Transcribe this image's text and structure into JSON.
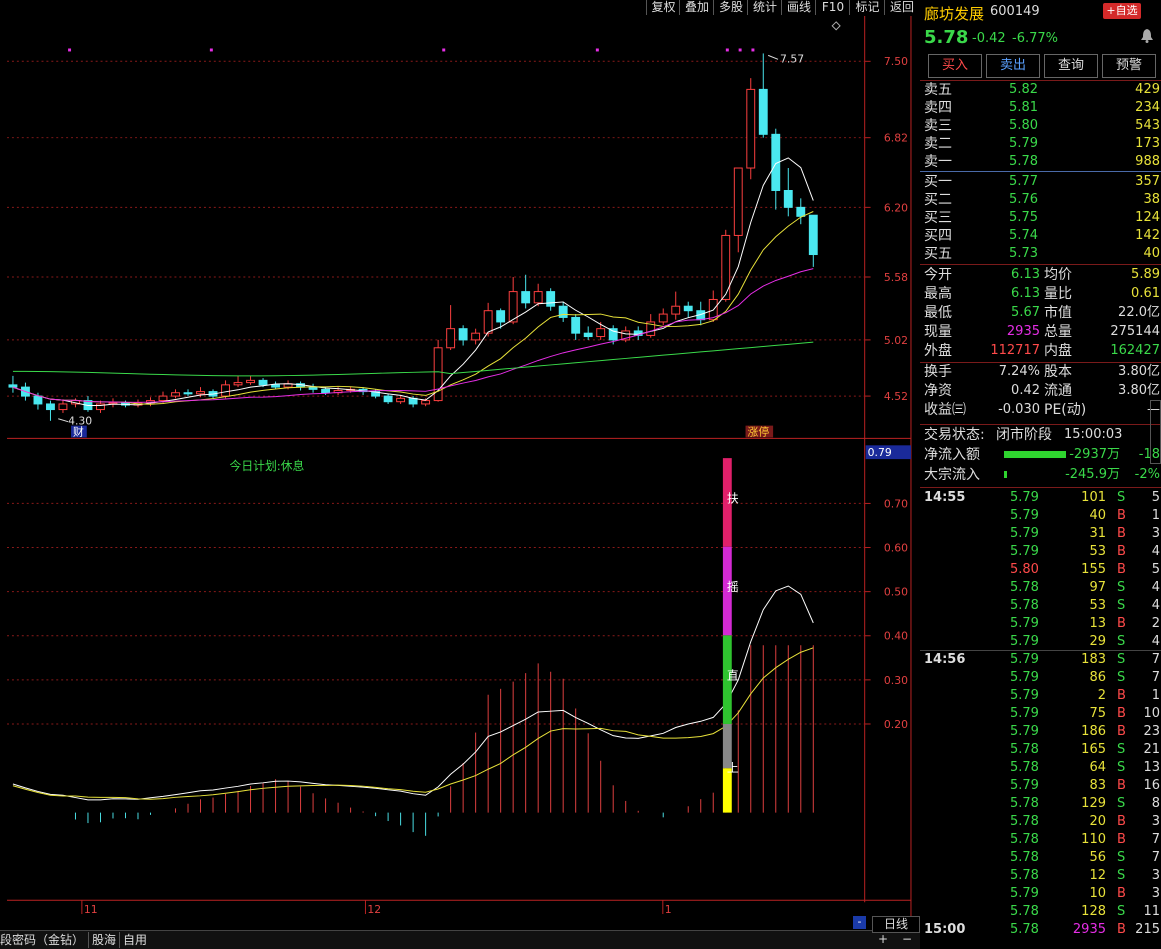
{
  "toolbar": {
    "buttons": [
      "复权",
      "叠加",
      "多股",
      "统计",
      "画线",
      "F10",
      "标记",
      "返回"
    ]
  },
  "chart_data": {
    "type": "candlestick",
    "price_axis_ticks": [
      "7.50",
      "6.82",
      "6.20",
      "5.58",
      "5.02",
      "4.52"
    ],
    "indicator_axis_ticks": [
      "0.70",
      "0.60",
      "0.50",
      "0.40",
      "0.30",
      "0.20"
    ],
    "indicator_current": "0.79",
    "x_ticks": [
      "11",
      "12",
      "1"
    ],
    "high_label": "7.57",
    "low_label": "4.30",
    "marker_labels": [
      "财",
      "涨停"
    ],
    "annotation": "今日计划:休息",
    "bar_labels": [
      "扶",
      "摇",
      "直",
      "上"
    ],
    "candles": [
      [
        4.62,
        4.6,
        4.7,
        4.55
      ],
      [
        4.6,
        4.52,
        4.64,
        4.48
      ],
      [
        4.52,
        4.45,
        4.55,
        4.4
      ],
      [
        4.45,
        4.4,
        4.48,
        4.3
      ],
      [
        4.4,
        4.45,
        4.49,
        4.37
      ],
      [
        4.45,
        4.48,
        4.5,
        4.42
      ],
      [
        4.48,
        4.4,
        4.52,
        4.38
      ],
      [
        4.4,
        4.45,
        4.48,
        4.37
      ],
      [
        4.45,
        4.46,
        4.5,
        4.42
      ],
      [
        4.46,
        4.44,
        4.48,
        4.42
      ],
      [
        4.44,
        4.46,
        4.49,
        4.42
      ],
      [
        4.46,
        4.48,
        4.51,
        4.43
      ],
      [
        4.48,
        4.52,
        4.56,
        4.46
      ],
      [
        4.52,
        4.55,
        4.58,
        4.5
      ],
      [
        4.55,
        4.54,
        4.58,
        4.52
      ],
      [
        4.54,
        4.56,
        4.6,
        4.51
      ],
      [
        4.56,
        4.52,
        4.58,
        4.5
      ],
      [
        4.52,
        4.62,
        4.66,
        4.5
      ],
      [
        4.62,
        4.64,
        4.7,
        4.6
      ],
      [
        4.64,
        4.66,
        4.7,
        4.62
      ],
      [
        4.66,
        4.62,
        4.68,
        4.6
      ],
      [
        4.62,
        4.6,
        4.65,
        4.58
      ],
      [
        4.6,
        4.63,
        4.66,
        4.58
      ],
      [
        4.63,
        4.6,
        4.65,
        4.57
      ],
      [
        4.6,
        4.58,
        4.63,
        4.55
      ],
      [
        4.58,
        4.55,
        4.6,
        4.53
      ],
      [
        4.55,
        4.57,
        4.6,
        4.53
      ],
      [
        4.57,
        4.58,
        4.6,
        4.55
      ],
      [
        4.58,
        4.56,
        4.6,
        4.53
      ],
      [
        4.56,
        4.52,
        4.58,
        4.5
      ],
      [
        4.52,
        4.47,
        4.54,
        4.45
      ],
      [
        4.47,
        4.5,
        4.53,
        4.45
      ],
      [
        4.5,
        4.45,
        4.52,
        4.42
      ],
      [
        4.45,
        4.48,
        4.5,
        4.43
      ],
      [
        4.48,
        4.95,
        5.02,
        4.47
      ],
      [
        4.95,
        5.12,
        5.33,
        4.93
      ],
      [
        5.12,
        5.02,
        5.15,
        4.97
      ],
      [
        5.02,
        5.08,
        5.12,
        4.98
      ],
      [
        5.08,
        5.28,
        5.35,
        5.05
      ],
      [
        5.28,
        5.18,
        5.3,
        5.12
      ],
      [
        5.18,
        5.45,
        5.58,
        5.16
      ],
      [
        5.45,
        5.35,
        5.6,
        5.3
      ],
      [
        5.35,
        5.45,
        5.52,
        5.32
      ],
      [
        5.45,
        5.32,
        5.48,
        5.28
      ],
      [
        5.32,
        5.22,
        5.36,
        5.18
      ],
      [
        5.22,
        5.08,
        5.25,
        5.02
      ],
      [
        5.08,
        5.05,
        5.14,
        5.02
      ],
      [
        5.05,
        5.12,
        5.18,
        5.02
      ],
      [
        5.12,
        5.02,
        5.15,
        4.98
      ],
      [
        5.02,
        5.1,
        5.14,
        5.0
      ],
      [
        5.1,
        5.06,
        5.14,
        5.02
      ],
      [
        5.06,
        5.18,
        5.25,
        5.04
      ],
      [
        5.18,
        5.25,
        5.3,
        5.15
      ],
      [
        5.25,
        5.32,
        5.45,
        5.2
      ],
      [
        5.32,
        5.28,
        5.36,
        5.22
      ],
      [
        5.28,
        5.2,
        5.36,
        5.15
      ],
      [
        5.2,
        5.38,
        5.46,
        5.18
      ],
      [
        5.38,
        5.95,
        6.0,
        5.36
      ],
      [
        5.95,
        6.55,
        6.55,
        5.8
      ],
      [
        6.55,
        7.25,
        7.35,
        6.45
      ],
      [
        7.25,
        6.85,
        7.57,
        6.82
      ],
      [
        6.85,
        6.35,
        6.9,
        6.18
      ],
      [
        6.35,
        6.2,
        6.55,
        6.12
      ],
      [
        6.2,
        6.12,
        6.28,
        6.05
      ],
      [
        6.13,
        5.78,
        6.13,
        5.67
      ]
    ]
  },
  "stock": {
    "name": "廊坊发展",
    "code": "600149",
    "price": "5.78",
    "change": "-0.42",
    "change_pct": "-6.77%",
    "watch_btn": "+自选"
  },
  "actions": {
    "buy": "买入",
    "sell": "卖出",
    "query": "查询",
    "alert": "预警"
  },
  "asks": [
    {
      "label": "卖五",
      "price": "5.82",
      "vol": "429"
    },
    {
      "label": "卖四",
      "price": "5.81",
      "vol": "234"
    },
    {
      "label": "卖三",
      "price": "5.80",
      "vol": "543"
    },
    {
      "label": "卖二",
      "price": "5.79",
      "vol": "173"
    },
    {
      "label": "卖一",
      "price": "5.78",
      "vol": "988"
    }
  ],
  "bids": [
    {
      "label": "买一",
      "price": "5.77",
      "vol": "357"
    },
    {
      "label": "买二",
      "price": "5.76",
      "vol": "38"
    },
    {
      "label": "买三",
      "price": "5.75",
      "vol": "124"
    },
    {
      "label": "买四",
      "price": "5.74",
      "vol": "142"
    },
    {
      "label": "买五",
      "price": "5.73",
      "vol": "40"
    }
  ],
  "stats": [
    {
      "l1": "今开",
      "v1": "6.13",
      "l2": "均价",
      "v2": "5.89"
    },
    {
      "l1": "最高",
      "v1": "6.13",
      "l2": "量比",
      "v2": "0.61"
    },
    {
      "l1": "最低",
      "v1": "5.67",
      "l2": "市值",
      "v2": "22.0亿"
    },
    {
      "l1": "现量",
      "v1": "2935",
      "l2": "总量",
      "v2": "275144"
    },
    {
      "l1": "外盘",
      "v1": "112717",
      "l2": "内盘",
      "v2": "162427"
    }
  ],
  "stats2": [
    {
      "l1": "换手",
      "v1": "7.24%",
      "l2": "股本",
      "v2": "3.80亿"
    },
    {
      "l1": "净资",
      "v1": "0.42",
      "l2": "流通",
      "v2": "3.80亿"
    },
    {
      "l1": "收益㈢",
      "v1": "-0.030",
      "l2": "PE(动)",
      "v2": "—"
    }
  ],
  "trade_status": {
    "label": "交易状态:",
    "value": "闭市阶段",
    "time": "15:00:03"
  },
  "flows": [
    {
      "label": "净流入额",
      "value": "-2937万",
      "pct": "-18"
    },
    {
      "label": "大宗流入",
      "value": "-245.9万",
      "pct": "-2%"
    }
  ],
  "ticks": [
    {
      "time": "14:55",
      "price": "5.79",
      "vol": "101",
      "side": "S",
      "n": "5"
    },
    {
      "time": "",
      "price": "5.79",
      "vol": "40",
      "side": "B",
      "n": "1"
    },
    {
      "time": "",
      "price": "5.79",
      "vol": "31",
      "side": "B",
      "n": "3"
    },
    {
      "time": "",
      "price": "5.79",
      "vol": "53",
      "side": "B",
      "n": "4"
    },
    {
      "time": "",
      "price": "5.80",
      "vol": "155",
      "side": "B",
      "n": "5"
    },
    {
      "time": "",
      "price": "5.78",
      "vol": "97",
      "side": "S",
      "n": "4"
    },
    {
      "time": "",
      "price": "5.78",
      "vol": "53",
      "side": "S",
      "n": "4"
    },
    {
      "time": "",
      "price": "5.79",
      "vol": "13",
      "side": "B",
      "n": "2"
    },
    {
      "time": "",
      "price": "5.79",
      "vol": "29",
      "side": "S",
      "n": "4"
    },
    {
      "time": "14:56",
      "price": "5.79",
      "vol": "183",
      "side": "S",
      "n": "7"
    },
    {
      "time": "",
      "price": "5.79",
      "vol": "86",
      "side": "S",
      "n": "7"
    },
    {
      "time": "",
      "price": "5.79",
      "vol": "2",
      "side": "B",
      "n": "1"
    },
    {
      "time": "",
      "price": "5.79",
      "vol": "75",
      "side": "B",
      "n": "10"
    },
    {
      "time": "",
      "price": "5.79",
      "vol": "186",
      "side": "B",
      "n": "23"
    },
    {
      "time": "",
      "price": "5.78",
      "vol": "165",
      "side": "S",
      "n": "21"
    },
    {
      "time": "",
      "price": "5.78",
      "vol": "64",
      "side": "S",
      "n": "13"
    },
    {
      "time": "",
      "price": "5.79",
      "vol": "83",
      "side": "B",
      "n": "16"
    },
    {
      "time": "",
      "price": "5.78",
      "vol": "129",
      "side": "S",
      "n": "8"
    },
    {
      "time": "",
      "price": "5.78",
      "vol": "20",
      "side": "B",
      "n": "3"
    },
    {
      "time": "",
      "price": "5.78",
      "vol": "110",
      "side": "B",
      "n": "7"
    },
    {
      "time": "",
      "price": "5.78",
      "vol": "56",
      "side": "S",
      "n": "7"
    },
    {
      "time": "",
      "price": "5.78",
      "vol": "12",
      "side": "S",
      "n": "3"
    },
    {
      "time": "",
      "price": "5.79",
      "vol": "10",
      "side": "B",
      "n": "3"
    },
    {
      "time": "",
      "price": "5.78",
      "vol": "128",
      "side": "S",
      "n": "11"
    },
    {
      "time": "15:00",
      "price": "5.78",
      "vol": "2935",
      "side": "B",
      "n": "215"
    }
  ],
  "bottom": {
    "tabs": [
      "段密码（金钻）",
      "股海",
      "自用"
    ],
    "period": "日线",
    "plus": "+",
    "minus": "−"
  }
}
